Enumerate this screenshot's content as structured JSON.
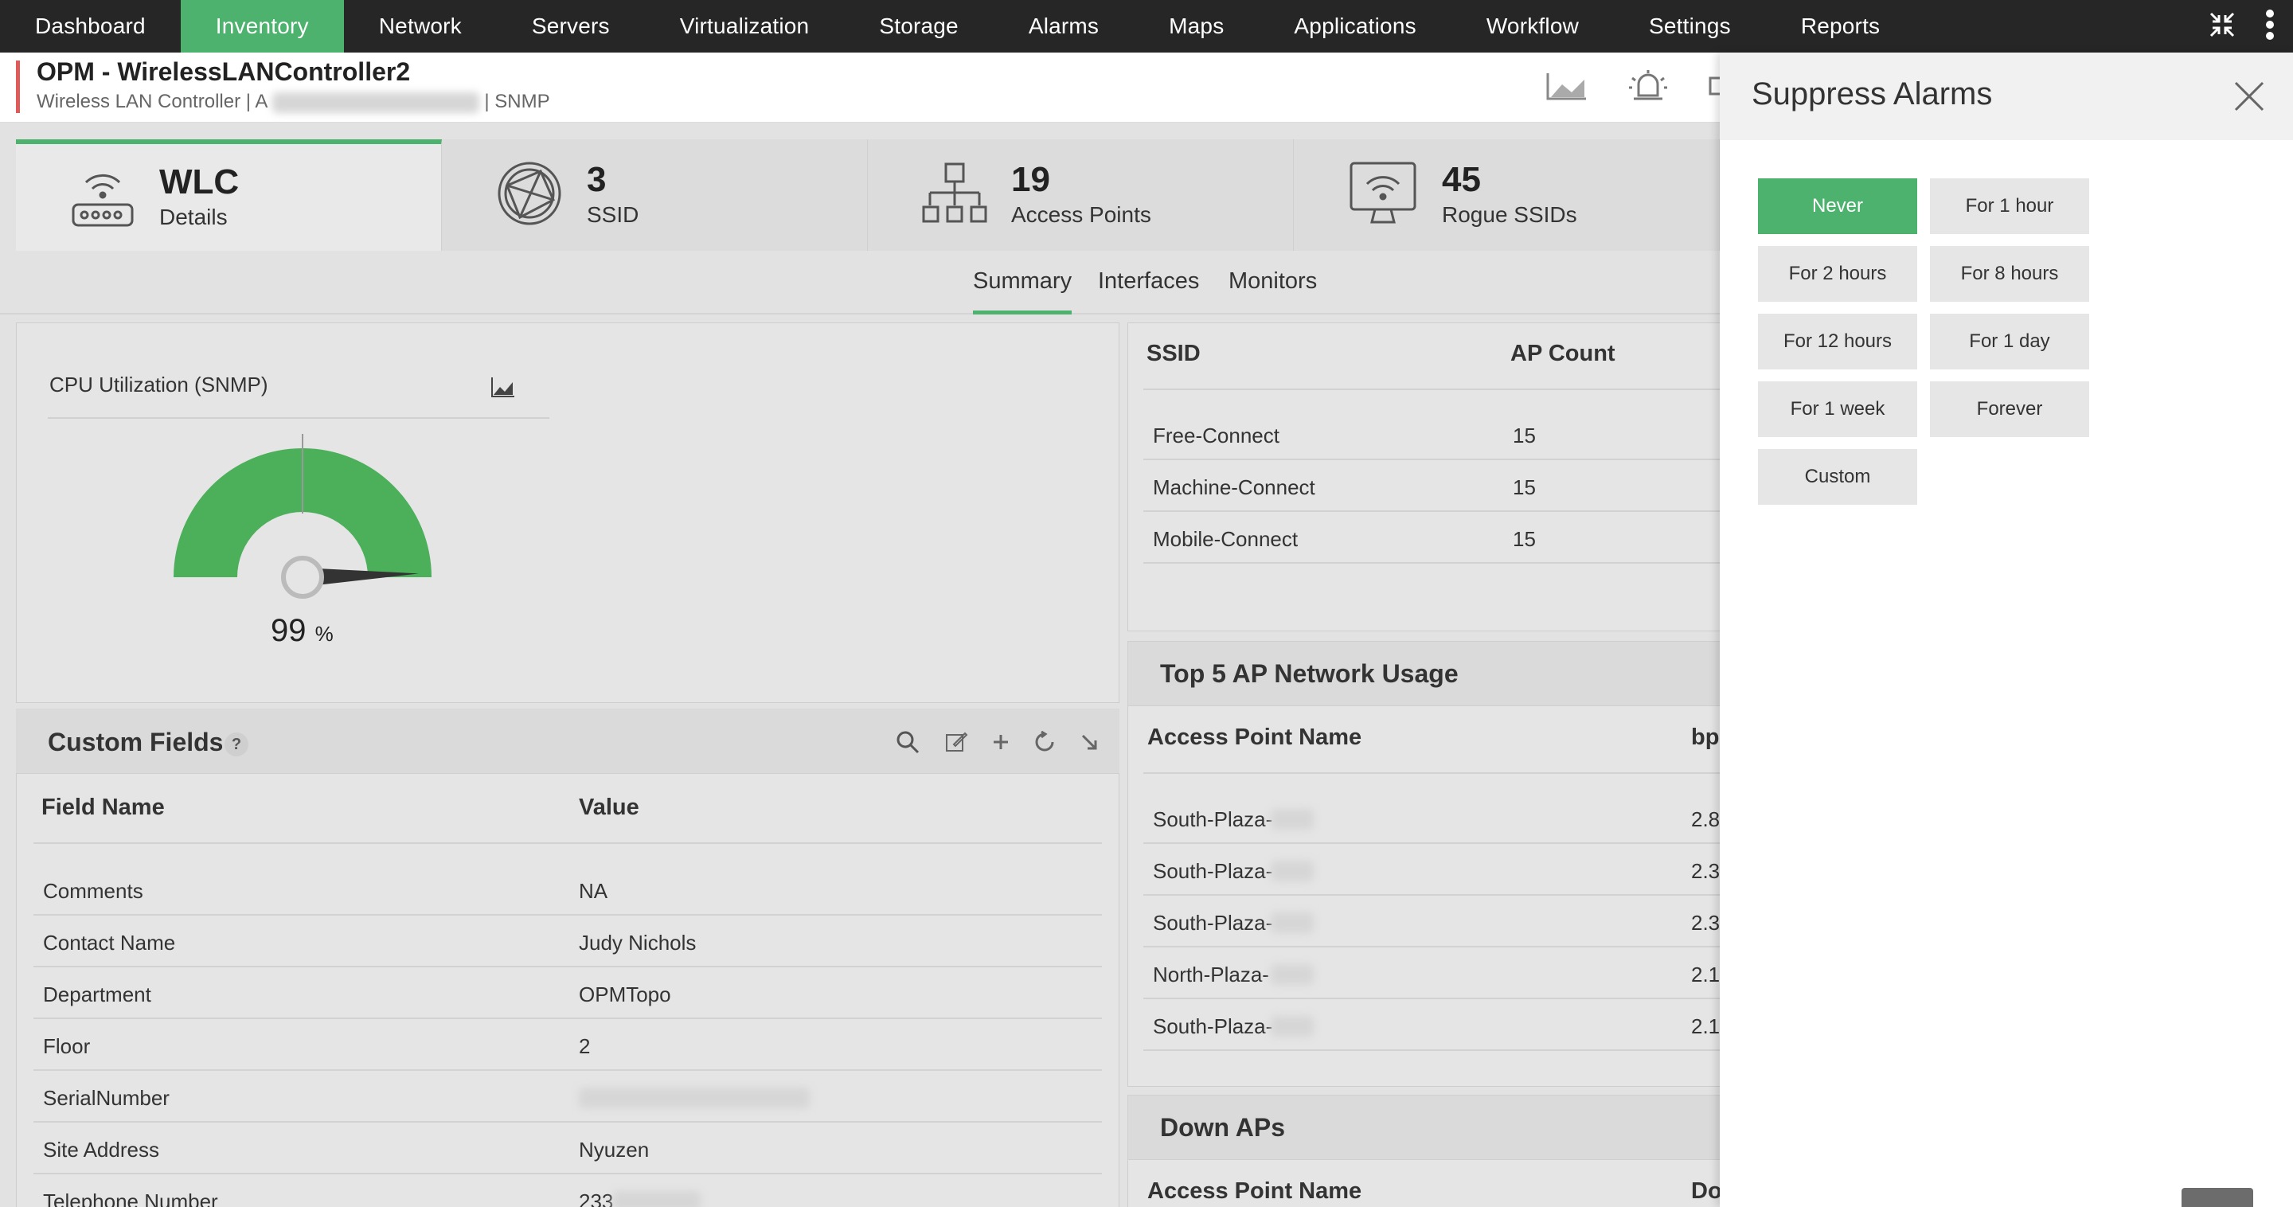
{
  "nav": {
    "items": [
      {
        "label": "Dashboard"
      },
      {
        "label": "Inventory",
        "active": true
      },
      {
        "label": "Network"
      },
      {
        "label": "Servers"
      },
      {
        "label": "Virtualization"
      },
      {
        "label": "Storage"
      },
      {
        "label": "Alarms"
      },
      {
        "label": "Maps"
      },
      {
        "label": "Applications"
      },
      {
        "label": "Workflow"
      },
      {
        "label": "Settings"
      },
      {
        "label": "Reports"
      }
    ],
    "icons": [
      "collapse-icon",
      "more-vertical-icon"
    ]
  },
  "header": {
    "title": "OPM - WirelessLANController2",
    "subtitle_prefix": "Wireless LAN Controller | A",
    "subtitle_suffix": "| SNMP"
  },
  "tiles": [
    {
      "value": "WLC",
      "label": "Details",
      "icon": "wlc-router-icon"
    },
    {
      "value": "3",
      "label": "SSID",
      "icon": "globe-icon"
    },
    {
      "value": "19",
      "label": "Access Points",
      "icon": "hierarchy-icon"
    },
    {
      "value": "45",
      "label": "Rogue SSIDs",
      "icon": "monitor-wifi-icon"
    }
  ],
  "subtabs": [
    "Summary",
    "Interfaces",
    "Monitors"
  ],
  "cpu": {
    "title": "CPU Utilization (SNMP)",
    "value": "99",
    "unit": "%",
    "fraction": 0.99
  },
  "custom_fields": {
    "title": "Custom Fields",
    "help": "?",
    "col_name": "Field Name",
    "col_value": "Value",
    "rows": [
      {
        "name": "Comments",
        "value": "NA"
      },
      {
        "name": "Contact Name",
        "value": "Judy Nichols"
      },
      {
        "name": "Department",
        "value": "OPMTopo"
      },
      {
        "name": "Floor",
        "value": "2"
      },
      {
        "name": "SerialNumber",
        "value": ""
      },
      {
        "name": "Site Address",
        "value": "Nyuzen"
      },
      {
        "name": "Telephone Number",
        "value": "233"
      }
    ]
  },
  "ssid_table": {
    "col_ssid": "SSID",
    "col_ap": "AP Count",
    "rows": [
      {
        "ssid": "Free-Connect",
        "ap": "15"
      },
      {
        "ssid": "Machine-Connect",
        "ap": "15"
      },
      {
        "ssid": "Mobile-Connect",
        "ap": "15"
      }
    ]
  },
  "top5": {
    "title": "Top 5 AP Network Usage",
    "col_name": "Access Point Name",
    "col_bps": "bp",
    "rows": [
      {
        "name": "South-Plaza-",
        "bps": "2.8"
      },
      {
        "name": "South-Plaza-",
        "bps": "2.3"
      },
      {
        "name": "South-Plaza-",
        "bps": "2.3"
      },
      {
        "name": "North-Plaza-",
        "bps": "2.1"
      },
      {
        "name": "South-Plaza-",
        "bps": "2.1"
      }
    ]
  },
  "down_aps": {
    "title": "Down APs",
    "col_name": "Access Point Name",
    "col_second": "Do"
  },
  "suppress": {
    "title": "Suppress Alarms",
    "options": [
      "Never",
      "For 1 hour",
      "For 2 hours",
      "For 8 hours",
      "For 12 hours",
      "For 1 day",
      "For 1 week",
      "Forever",
      "Custom"
    ],
    "selected": "Never"
  },
  "colors": {
    "accent": "#4db26e",
    "nav_bg": "#262626",
    "header_marker": "#e15a5a"
  }
}
